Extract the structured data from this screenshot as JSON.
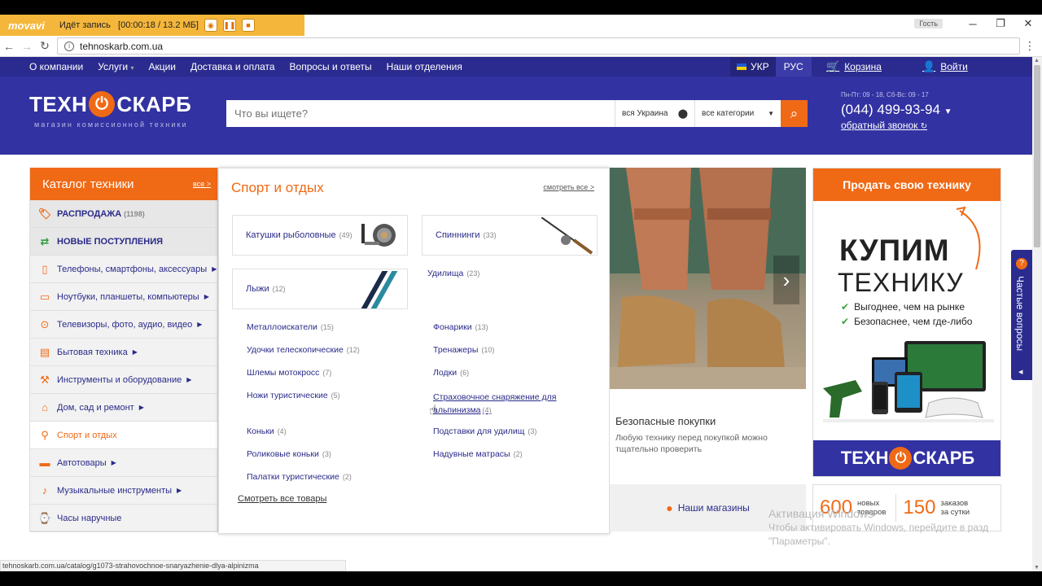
{
  "recorder": {
    "logo": "movavi",
    "status": "Идёт запись",
    "time": "[00:00:18 / 13.2 МБ]"
  },
  "window": {
    "guest": "Гость"
  },
  "browser": {
    "url": "tehnoskarb.com.ua"
  },
  "topnav": {
    "items": [
      "О компании",
      "Услуги",
      "Акции",
      "Доставка и оплата",
      "Вопросы и ответы",
      "Наши отделения"
    ],
    "lang_ua": "УКР",
    "lang_ru": "РУС",
    "cart": "Корзина",
    "login": "Войти"
  },
  "header": {
    "logo_left": "ТЕХН",
    "logo_right": "СКАРБ",
    "tagline": "магазин комиссионной техники",
    "search_placeholder": "Что вы ищете?",
    "location": "вся Украина",
    "category": "все категории",
    "hours": "Пн-Пт: 09 - 18, Сб-Вс: 09 - 17",
    "phone": "(044) 499-93-94",
    "callback": "обратный звонок"
  },
  "catalog": {
    "title": "Каталог техники",
    "all": "все >",
    "items": [
      {
        "label": "РАСПРОДАЖА",
        "count": "(1198)",
        "icon": "sale-tag-icon"
      },
      {
        "label": "НОВЫЕ ПОСТУПЛЕНИЯ",
        "count": "",
        "icon": "refresh-icon"
      },
      {
        "label": "Телефоны, смартфоны, аксессуары",
        "icon": "phone-icon"
      },
      {
        "label": "Ноутбуки, планшеты, компьютеры",
        "icon": "laptop-icon"
      },
      {
        "label": "Телевизоры, фото, аудио, видео",
        "icon": "play-icon"
      },
      {
        "label": "Бытовая техника",
        "icon": "appliance-icon"
      },
      {
        "label": "Инструменты и оборудование",
        "icon": "drill-icon"
      },
      {
        "label": "Дом, сад и ремонт",
        "icon": "house-icon"
      },
      {
        "label": "Спорт и отдых",
        "icon": "bicycle-icon"
      },
      {
        "label": "Автотовары",
        "icon": "car-icon"
      },
      {
        "label": "Музыкальные инструменты",
        "icon": "guitar-icon"
      },
      {
        "label": "Часы наручные",
        "icon": "watch-icon"
      }
    ]
  },
  "menu": {
    "title": "Спорт и отдых",
    "see_all": "смотреть все >",
    "cards": [
      {
        "label": "Катушки рыболовные",
        "count": "(49)"
      },
      {
        "label": "Спиннинги",
        "count": "(33)"
      },
      {
        "label": "Лыжи",
        "count": "(12)"
      }
    ],
    "rod": {
      "label": "Удилища",
      "count": "(23)"
    },
    "left_links": [
      {
        "label": "Металлоискатели",
        "count": "(15)"
      },
      {
        "label": "Удочки телескопические",
        "count": "(12)"
      },
      {
        "label": "Шлемы мотокросс",
        "count": "(7)"
      },
      {
        "label": "Ножи туристические",
        "count": "(5)"
      },
      {
        "label": "Коньки",
        "count": "(4)"
      },
      {
        "label": "Роликовые коньки",
        "count": "(3)"
      },
      {
        "label": "Палатки туристические",
        "count": "(2)"
      }
    ],
    "right_links": [
      {
        "label": "Фонарики",
        "count": "(13)"
      },
      {
        "label": "Тренажеры",
        "count": "(10)"
      },
      {
        "label": "Лодки",
        "count": "(6)"
      },
      {
        "label": "Страховочное снаряжение для",
        "label2": "альпинизма",
        "count": "(4)"
      },
      {
        "label": "Подставки для удилищ",
        "count": "(3)"
      },
      {
        "label": "Надувные матрасы",
        "count": "(2)"
      }
    ],
    "all_goods": "Смотреть все товары"
  },
  "promo": {
    "safe_title": "Безопасные покупки",
    "safe_line1": "Любую технику перед покупкой можно",
    "safe_line2": "тщательно проверить",
    "stores": "Наши магазины"
  },
  "sell": {
    "button": "Продать свою технику",
    "line1": "КУПИМ",
    "line2": "ТЕХНИКУ",
    "bullet1": "Выгоднее, чем на рынке",
    "bullet2": "Безопаснее, чем где-либо",
    "foot_left": "ТЕХН",
    "foot_right": "СКАРБ"
  },
  "stats": {
    "n1": "600",
    "l1a": "новых",
    "l1b": "товаров",
    "n2": "150",
    "l2a": "заказов",
    "l2b": "за сутки"
  },
  "faq": {
    "label": "Частые вопросы"
  },
  "watermark": {
    "line1": "Активация Windows",
    "line2": "Чтобы активировать Windows, перейдите в разд",
    "line3": "\"Параметры\"."
  },
  "statusbar": {
    "url": "tehnoskarb.com.ua/catalog/g1073-strahovochnoe-snaryazhenie-dlya-alpinizma"
  },
  "colors": {
    "accent": "#f06a16",
    "brand": "#3232a2",
    "nav": "#2b2b8f",
    "link": "#2a2a8a"
  }
}
